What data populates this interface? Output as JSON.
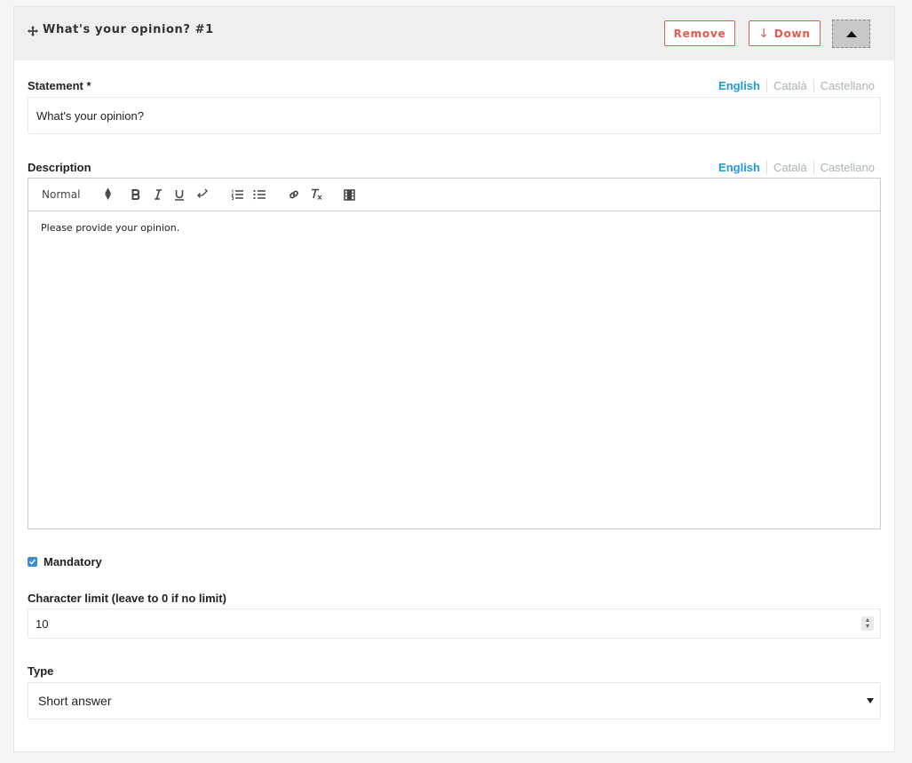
{
  "header": {
    "title": "What's your opinion? #1",
    "remove_label": "Remove",
    "down_label": "Down",
    "down_arrow": "↓"
  },
  "languages": [
    "English",
    "Català",
    "Castellano"
  ],
  "statement": {
    "label": "Statement *",
    "value": "What's your opinion?"
  },
  "description": {
    "label": "Description",
    "format_value": "Normal",
    "toolbar_icons": [
      "bold-icon",
      "italic-icon",
      "underline-icon",
      "return-icon",
      "ordered-list-icon",
      "bullet-list-icon",
      "link-icon",
      "clear-format-icon",
      "video-icon"
    ],
    "body": "Please provide your opinion."
  },
  "mandatory": {
    "label": "Mandatory",
    "checked": true
  },
  "character_limit": {
    "label": "Character limit (leave to 0 if no limit)",
    "value": "10"
  },
  "type": {
    "label": "Type",
    "value": "Short answer"
  },
  "colors": {
    "accent": "#1e9ad6",
    "danger": "#e05a4e",
    "checkbox": "#3a8fd6"
  }
}
